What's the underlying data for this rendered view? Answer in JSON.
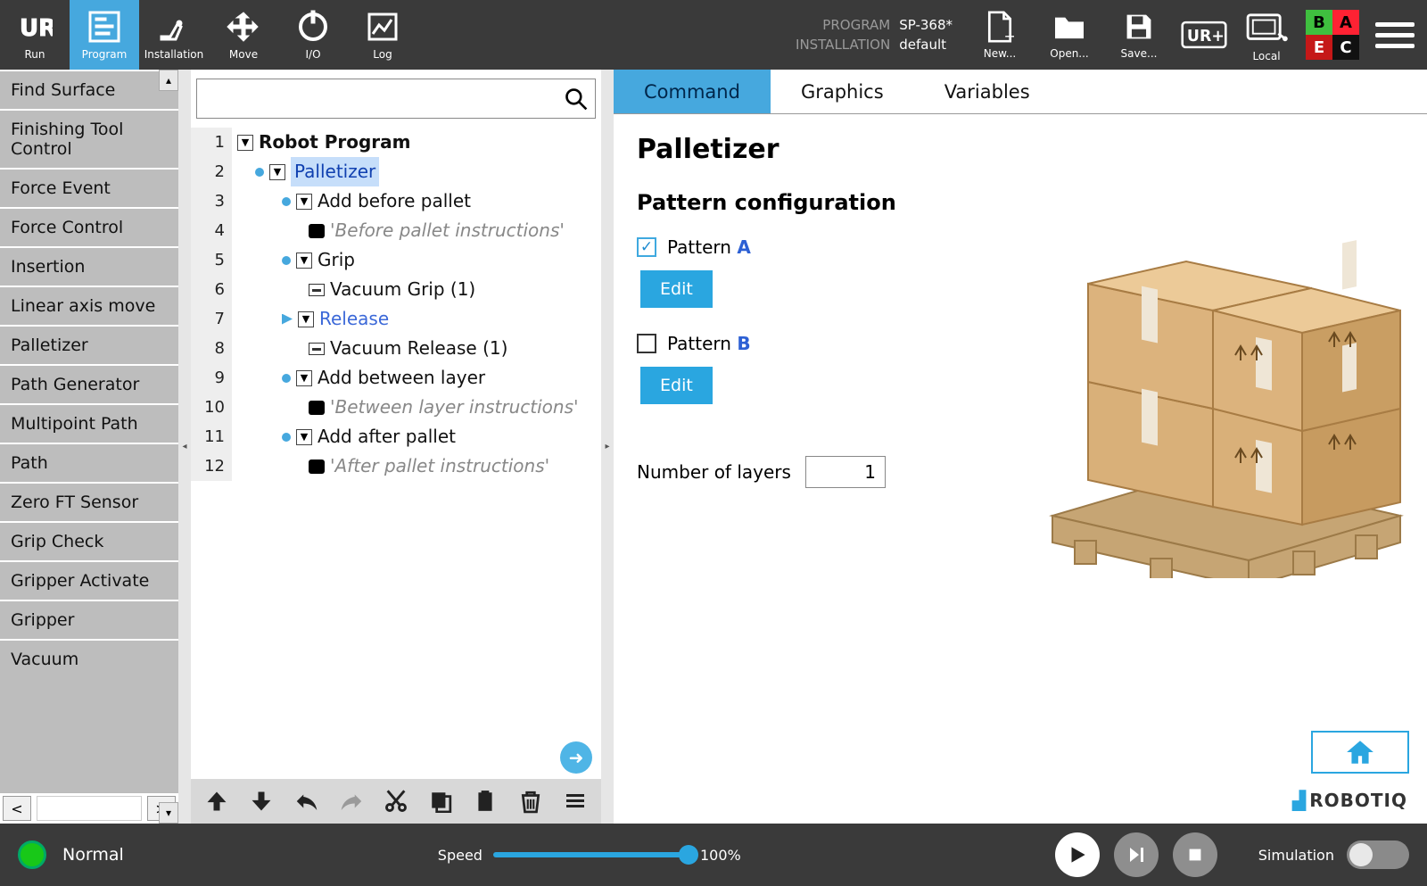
{
  "topbar": {
    "items": [
      {
        "name": "run-tab",
        "label": "Run"
      },
      {
        "name": "program-tab",
        "label": "Program"
      },
      {
        "name": "installation-tab",
        "label": "Installation"
      },
      {
        "name": "move-tab",
        "label": "Move"
      },
      {
        "name": "io-tab",
        "label": "I/O"
      },
      {
        "name": "log-tab",
        "label": "Log"
      }
    ],
    "program_key": "PROGRAM",
    "program_value": "SP-368*",
    "installation_key": "INSTALLATION",
    "installation_value": "default",
    "file_buttons": [
      {
        "name": "new-button",
        "label": "New..."
      },
      {
        "name": "open-button",
        "label": "Open..."
      },
      {
        "name": "save-button",
        "label": "Save..."
      }
    ],
    "local_label": "Local",
    "quad": {
      "tl": "B",
      "tr": "A",
      "bl": "E",
      "br": "C"
    }
  },
  "sidebar": {
    "items": [
      "Find Surface",
      "Finishing Tool Control",
      "Force Event",
      "Force Control",
      "Insertion",
      "Linear axis move",
      "Palletizer",
      "Path Generator",
      "Multipoint Path",
      "Path",
      "Zero FT Sensor",
      "Grip Check",
      "Gripper Activate",
      "Gripper",
      "Vacuum"
    ]
  },
  "tree": {
    "search_placeholder": "",
    "rows": [
      {
        "n": 1,
        "indent": 0,
        "icons": [
          "tri"
        ],
        "text": "Robot Program",
        "mod": "bold"
      },
      {
        "n": 2,
        "indent": 1,
        "icons": [
          "pin",
          "tri"
        ],
        "text": "Palletizer",
        "mod": "sel"
      },
      {
        "n": 3,
        "indent": 2,
        "icons": [
          "pin",
          "tri"
        ],
        "text": "Add before pallet"
      },
      {
        "n": 4,
        "indent": 3,
        "icons": [
          "cmnt"
        ],
        "text": "'Before pallet instructions'",
        "mod": "gray"
      },
      {
        "n": 5,
        "indent": 2,
        "icons": [
          "pin",
          "tri"
        ],
        "text": "Grip"
      },
      {
        "n": 6,
        "indent": 3,
        "icons": [
          "bar"
        ],
        "text": "Vacuum Grip  (1)"
      },
      {
        "n": 7,
        "indent": 2,
        "icons": [
          "ptr",
          "tri"
        ],
        "text": "Release",
        "mod": "link"
      },
      {
        "n": 8,
        "indent": 3,
        "icons": [
          "bar"
        ],
        "text": "Vacuum Release  (1)"
      },
      {
        "n": 9,
        "indent": 2,
        "icons": [
          "pin",
          "tri"
        ],
        "text": "Add between layer"
      },
      {
        "n": 10,
        "indent": 3,
        "icons": [
          "cmnt"
        ],
        "text": "'Between layer instructions'",
        "mod": "gray"
      },
      {
        "n": 11,
        "indent": 2,
        "icons": [
          "pin",
          "tri"
        ],
        "text": "Add after pallet"
      },
      {
        "n": 12,
        "indent": 3,
        "icons": [
          "cmnt"
        ],
        "text": "'After pallet instructions'",
        "mod": "gray"
      }
    ]
  },
  "rtabs": [
    {
      "name": "command-tab",
      "label": "Command",
      "active": true
    },
    {
      "name": "graphics-tab",
      "label": "Graphics",
      "active": false
    },
    {
      "name": "variables-tab",
      "label": "Variables",
      "active": false
    }
  ],
  "panel": {
    "title": "Palletizer",
    "subtitle": "Pattern configuration",
    "patternA_label": "Pattern",
    "patternA_letter": "A",
    "patternB_label": "Pattern",
    "patternB_letter": "B",
    "edit_label": "Edit",
    "layers_label": "Number of layers",
    "layers_value": "1",
    "brand": "ROBOTIQ"
  },
  "footer": {
    "status": "Normal",
    "speed_label": "Speed",
    "speed_value": "100%",
    "simulation_label": "Simulation"
  }
}
